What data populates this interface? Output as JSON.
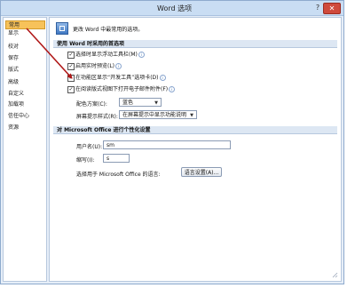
{
  "window": {
    "title": "Word 选项",
    "help_glyph": "?",
    "close_glyph": "✕"
  },
  "nav": {
    "items": [
      {
        "label": "常用",
        "selected": true
      },
      {
        "label": "显示"
      },
      {
        "label": "校对"
      },
      {
        "label": "保存"
      },
      {
        "label": "版式"
      },
      {
        "label": "高级"
      },
      {
        "label": "自定义"
      },
      {
        "label": "加载项"
      },
      {
        "label": "信任中心"
      },
      {
        "label": "资源"
      }
    ]
  },
  "intro": {
    "text": "更改 Word 中最常用的选项。"
  },
  "section1": {
    "header": "使用 Word 时采用的首选项",
    "options": [
      {
        "label": "选择时显示浮动工具栏(M)",
        "checked": true
      },
      {
        "label": "启用实时预览(L)",
        "checked": true
      },
      {
        "label": "在功能区显示“开发工具”选项卡(D)",
        "checked": true
      },
      {
        "label": "在阅读版式视图下打开电子邮件附件(F)",
        "checked": true
      }
    ],
    "color_scheme_label": "配色方案(C):",
    "color_scheme_value": "蓝色",
    "tooltip_style_label": "屏幕提示样式(R):",
    "tooltip_style_value": "在屏幕提示中显示功能说明"
  },
  "section2": {
    "header": "对 Microsoft Office 进行个性化设置",
    "username_label": "用户名(U):",
    "username_value": "sm",
    "initials_label": "缩写(I):",
    "initials_value": "s",
    "language_label": "选择用于 Microsoft Office 的语言:",
    "language_button": "语言设置(A)..."
  },
  "icons": {
    "checkmark": "✓",
    "info": "i",
    "dropdown": "▼"
  },
  "colors": {
    "accent_selected": "#f7c25a",
    "annotation_arrow": "#b01818",
    "close": "#cf4a3c"
  }
}
